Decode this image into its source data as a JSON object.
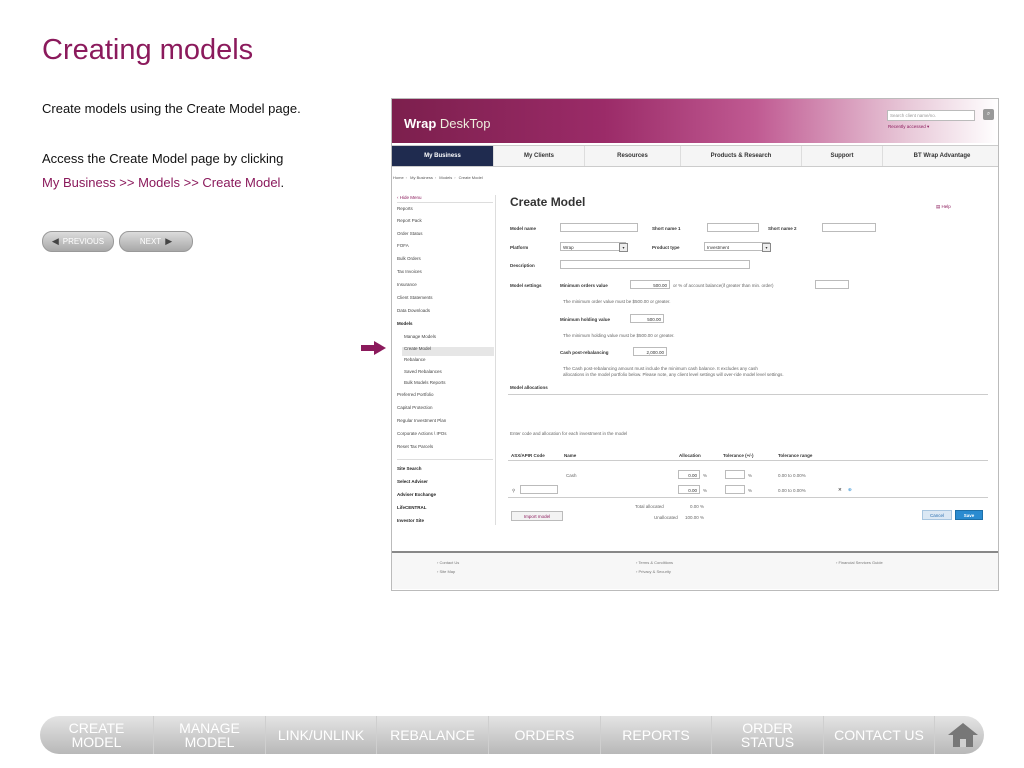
{
  "page": {
    "title": "Creating models",
    "intro": "Create models using the Create Model page.",
    "access_text": "Access the Create Model page by clicking",
    "nav_path": "My Business >> Models >> Create Model",
    "nav_path_end": ".",
    "prev_label": "PREVIOUS",
    "next_label": "NEXT"
  },
  "screenshot": {
    "logo_brand": "Wrap",
    "logo_suffix": "DeskTop",
    "search_placeholder": "Search client name/no.",
    "recently_accessed": "Recently accessed ▾",
    "nav_tabs": [
      "My Business",
      "My Clients",
      "Resources",
      "Products & Research",
      "Support",
      "BT Wrap Advantage"
    ],
    "breadcrumb": [
      "Home",
      "My Business",
      "Models",
      "Create Model"
    ],
    "sidebar": {
      "hide_menu": "‹ Hide Menu",
      "items": [
        "Reports",
        "Report Pack",
        "Order Status",
        "FOFA",
        "Bulk Orders",
        "Tax Invoices",
        "Insurance",
        "Client Statements",
        "Data Downloads",
        "Models"
      ],
      "model_items": [
        "Manage Models",
        "Create Model",
        "Rebalance",
        "Saved Rebalances",
        "Bulk Models Reports"
      ],
      "more_items": [
        "Preferred Portfolio",
        "Capital Protection",
        "Regular Investment Plan",
        "Corporate Actions \\ IPOs",
        "Reset Tax Parcels"
      ],
      "tools": [
        "Site Search",
        "Select Adviser",
        "Adviser Exchange",
        "LifeCENTRAL",
        "Investor Site"
      ]
    },
    "form": {
      "heading": "Create Model",
      "help": "Help",
      "model_name": "Model name",
      "short_name_1": "Short name 1",
      "short_name_2": "Short name 2",
      "platform": "Platform",
      "platform_value": "Wrap",
      "product_type": "Product type",
      "product_type_value": "Investment",
      "description": "Description",
      "model_settings": "Model settings",
      "min_orders_label": "Minimum orders value",
      "min_orders_value": "500.00",
      "min_orders_suffix": "or % of account balance(if greater than min. order)",
      "min_orders_note": "The minimum order value must be $500.00 or greater.",
      "min_holding_label": "Minimum holding value",
      "min_holding_value": "500.00",
      "min_holding_note": "The minimum holding value must be $500.00 or greater.",
      "cash_label": "Cash post-rebalancing",
      "cash_value": "2,000.00",
      "cash_note_1": "The Cash post-rebalancing amount must include the minimum cash balance. It excludes any cash",
      "cash_note_2": "allocations in the model portfolio below. Please note, any client level settings will over-ride model level settings.",
      "model_allocations": "Model allocations",
      "alloc_hint": "Enter code and allocation for each investment in the model",
      "columns": [
        "ASX/APIR Code",
        "Name",
        "Allocation",
        "Tolerance (+/-)",
        "Tolerance range"
      ],
      "row1_name": "Cash",
      "row1_alloc": "0.00",
      "row1_range": "0.00 to 0.00%",
      "row2_alloc": "0.00",
      "row2_range": "0.00 to 0.00%",
      "percent": "%",
      "total_allocated_label": "Total allocated",
      "total_allocated_value": "0.00 %",
      "unallocated_label": "Unallocated",
      "unallocated_value": "100.00 %",
      "import_model": "Import model",
      "cancel": "Cancel",
      "save": "Save"
    },
    "footer": {
      "contact": "› Contact Us",
      "site_map": "› Site Map",
      "terms": "› Terms & Conditions",
      "privacy": "› Privacy & Security",
      "fsg": "› Financial Services Guide"
    }
  },
  "bottom_nav": [
    "CREATE\nMODEL",
    "MANAGE\nMODEL",
    "LINK/UNLINK",
    "REBALANCE",
    "ORDERS",
    "REPORTS",
    "ORDER\nSTATUS",
    "CONTACT US"
  ]
}
